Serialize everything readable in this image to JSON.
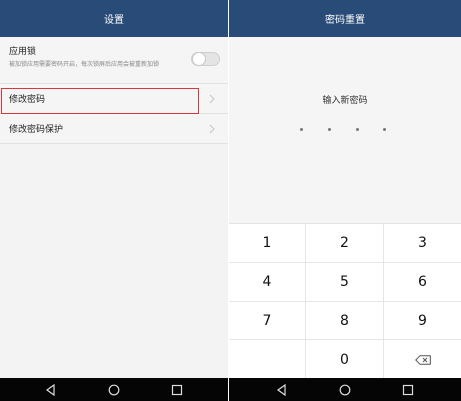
{
  "left_screen": {
    "title": "设置",
    "app_lock": {
      "title": "应用锁",
      "description": "被加锁应用需要密码开启，每次锁屏后应用会被重新加锁"
    },
    "change_password": {
      "label": "修改密码"
    },
    "change_password_protection": {
      "label": "修改密码保护"
    }
  },
  "right_screen": {
    "title": "密码重置",
    "prompt": "输入新密码",
    "keypad": {
      "k1": "1",
      "k2": "2",
      "k3": "3",
      "k4": "4",
      "k5": "5",
      "k6": "6",
      "k7": "7",
      "k8": "8",
      "k9": "9",
      "k0": "0"
    }
  },
  "colors": {
    "header": "#294b78",
    "highlight": "#d9363e",
    "navbar": "#050505"
  },
  "icons": [
    "chevron-right-icon",
    "backspace-icon",
    "nav-back-icon",
    "nav-home-icon",
    "nav-recents-icon"
  ],
  "toggle_state": "off"
}
